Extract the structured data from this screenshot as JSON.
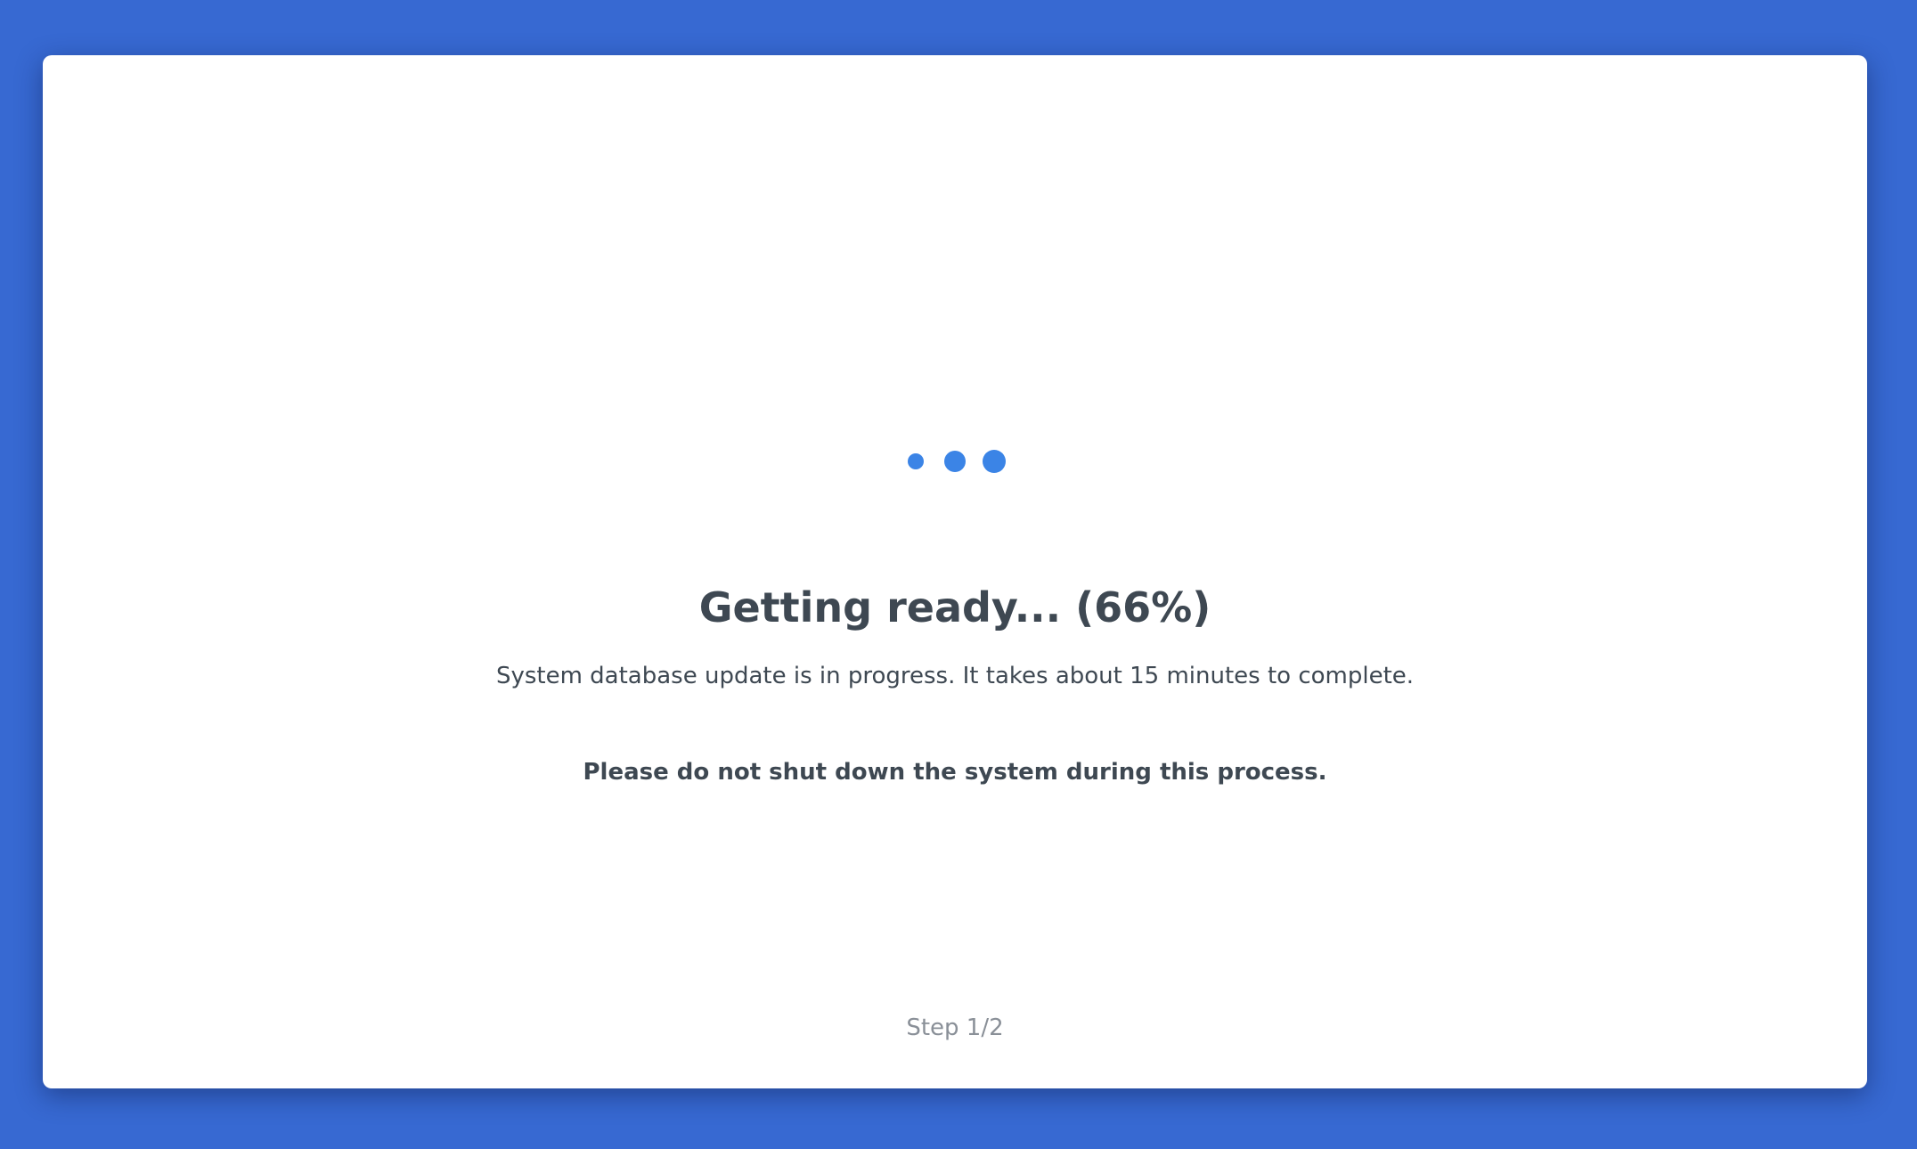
{
  "loader": {
    "icon": "loading-dots-icon",
    "color": "#3b84e6",
    "dots": 3
  },
  "status": {
    "title": "Getting ready... (66%)",
    "progress_percent": 66,
    "description": "System database update is in progress. It takes about 15 minutes to complete.",
    "warning": "Please do not shut down the system during this process."
  },
  "footer": {
    "step": "Step 1/2"
  },
  "theme": {
    "background": "#3769d2",
    "card": "#ffffff",
    "text": "#3e4852",
    "muted_text": "#8a9098"
  }
}
